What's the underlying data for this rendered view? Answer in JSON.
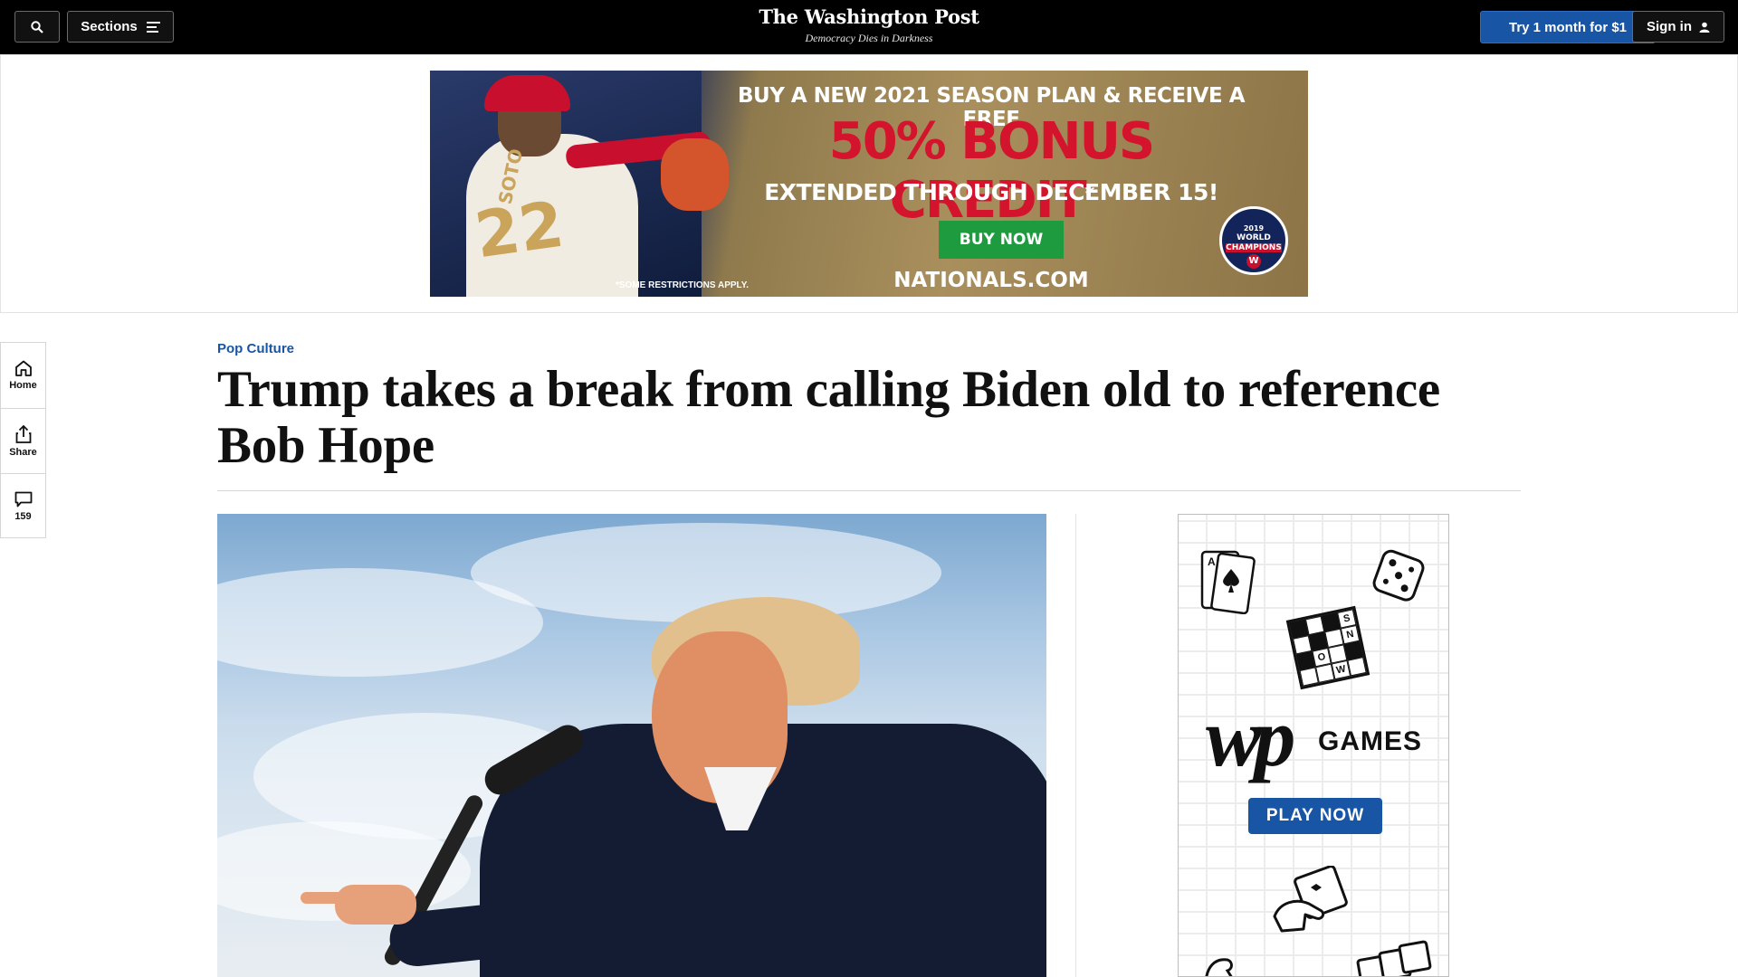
{
  "header": {
    "search_icon": "search-icon",
    "sections_label": "Sections",
    "logo_text": "The Washington Post",
    "tagline": "Democracy Dies in Darkness",
    "subscribe_label": "Try 1 month for $1",
    "signin_label": "Sign in"
  },
  "top_ad": {
    "headline1": "BUY A NEW 2021 SEASON PLAN & RECEIVE A FREE",
    "headline2": "50% BONUS CREDIT",
    "asterisk": "*",
    "headline3": "EXTENDED THROUGH DECEMBER 15!",
    "cta": "BUY NOW",
    "url": "NATIONALS.COM",
    "restrictions": "*SOME RESTRICTIONS APPLY.",
    "player_name": "SOTO",
    "player_number": "22",
    "badge_year": "2019",
    "badge_line1": "WORLD",
    "badge_line2": "CHAMPIONS",
    "badge_letter": "W"
  },
  "rail": {
    "home_label": "Home",
    "share_label": "Share",
    "comments_count": "159"
  },
  "article": {
    "kicker": "Pop Culture",
    "headline": "Trump takes a break from calling Biden old to reference Bob Hope"
  },
  "side_ad": {
    "logo": "wp",
    "games_label": "GAMES",
    "cta": "PLAY NOW",
    "crossword_letters": [
      "S",
      "N",
      "O",
      "W"
    ],
    "card_letter": "A"
  },
  "colors": {
    "accent_blue": "#1955a5",
    "nationals_red": "#d4132c",
    "buy_green": "#1e9b3e"
  }
}
